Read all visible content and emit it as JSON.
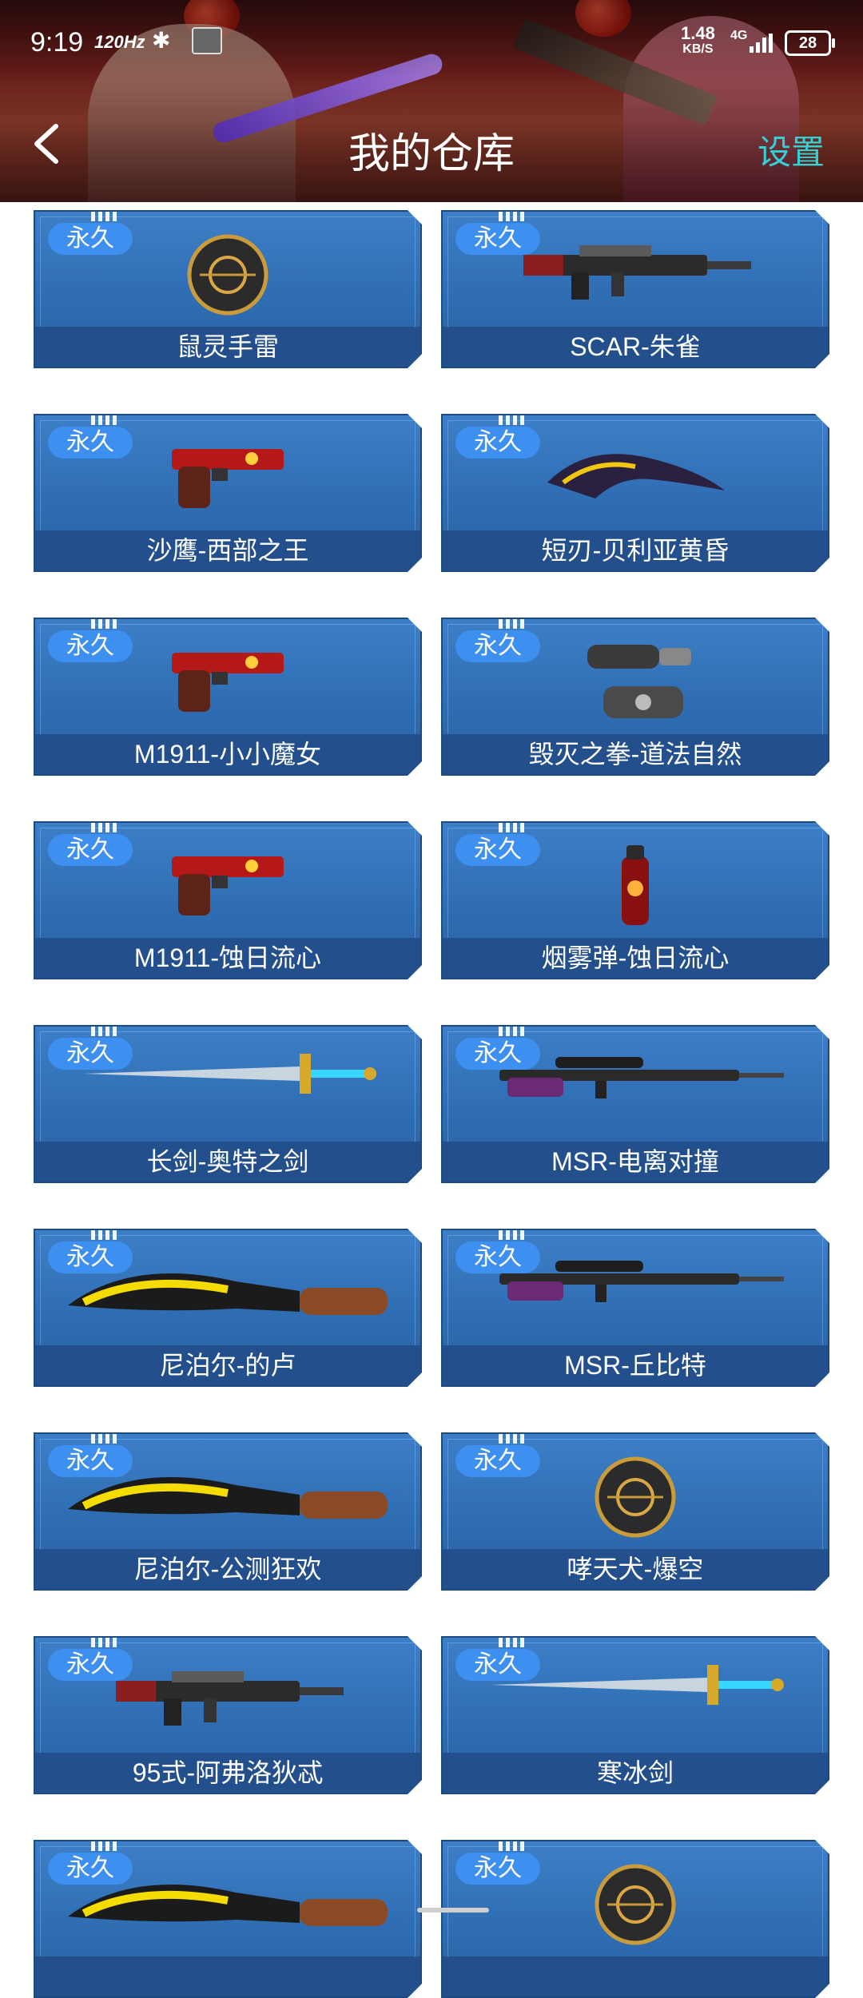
{
  "status_bar": {
    "time": "9:19",
    "refresh": "120Hz",
    "speed_value": "1.48",
    "speed_unit": "KB/S",
    "network": "4G",
    "battery": "28"
  },
  "header": {
    "title": "我的仓库",
    "settings_label": "设置"
  },
  "items": [
    {
      "badge": "永久",
      "name": "鼠灵手雷",
      "icon": "grenade-icon"
    },
    {
      "badge": "永久",
      "name": "SCAR-朱雀",
      "icon": "rifle-icon"
    },
    {
      "badge": "永久",
      "name": "沙鹰-西部之王",
      "icon": "pistol-icon"
    },
    {
      "badge": "永久",
      "name": "短刃-贝利亚黄昏",
      "icon": "blade-icon"
    },
    {
      "badge": "永久",
      "name": "M1911-小小魔女",
      "icon": "pistol-icon"
    },
    {
      "badge": "永久",
      "name": "毁灭之拳-道法自然",
      "icon": "gauntlet-icon"
    },
    {
      "badge": "永久",
      "name": "M1911-蚀日流心",
      "icon": "pistol-icon"
    },
    {
      "badge": "永久",
      "name": "烟雾弹-蚀日流心",
      "icon": "smoke-grenade-icon"
    },
    {
      "badge": "永久",
      "name": "长剑-奥特之剑",
      "icon": "sword-icon"
    },
    {
      "badge": "永久",
      "name": "MSR-电离对撞",
      "icon": "sniper-icon"
    },
    {
      "badge": "永久",
      "name": "尼泊尔-的卢",
      "icon": "kukri-icon"
    },
    {
      "badge": "永久",
      "name": "MSR-丘比特",
      "icon": "sniper-icon"
    },
    {
      "badge": "永久",
      "name": "尼泊尔-公测狂欢",
      "icon": "kukri-icon"
    },
    {
      "badge": "永久",
      "name": "哮天犬-爆空",
      "icon": "grenade-icon"
    },
    {
      "badge": "永久",
      "name": "95式-阿弗洛狄忒",
      "icon": "rifle-icon"
    },
    {
      "badge": "永久",
      "name": "寒冰剑",
      "icon": "sword-icon"
    },
    {
      "badge": "永久",
      "name": "",
      "icon": "kukri-icon"
    },
    {
      "badge": "永久",
      "name": "",
      "icon": "grenade-icon"
    }
  ]
}
